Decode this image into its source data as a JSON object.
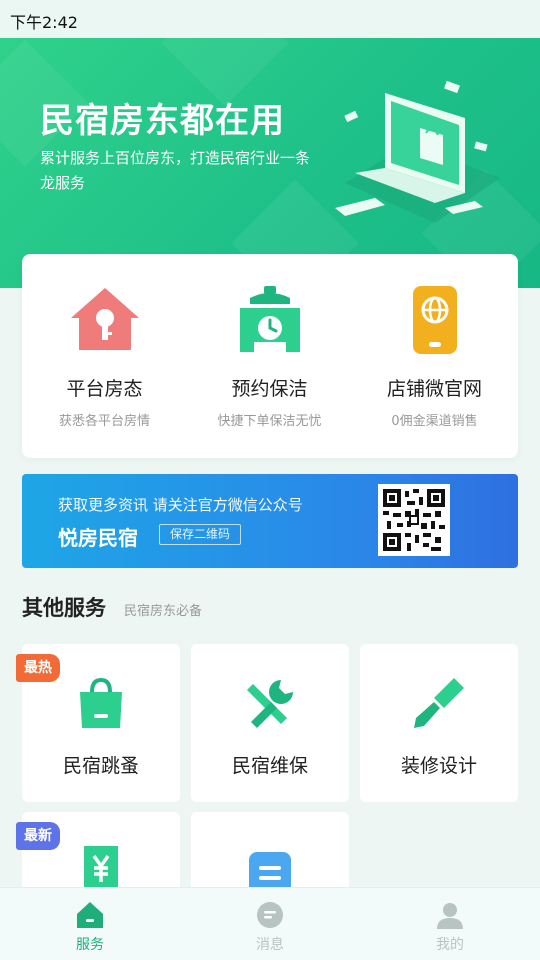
{
  "status_bar": {
    "time": "下午2:42"
  },
  "hero": {
    "title": "民宿房东都在用",
    "subtitle": "累计服务上百位房东，打造民宿行业一条龙服务"
  },
  "main_services": [
    {
      "title": "平台房态",
      "desc": "获悉各平台房情",
      "icon": "house-key-icon"
    },
    {
      "title": "预约保洁",
      "desc": "快捷下单保洁无忧",
      "icon": "clock-cleaning-icon"
    },
    {
      "title": "店铺微官网",
      "desc": "0佣金渠道销售",
      "icon": "phone-globe-icon"
    }
  ],
  "banner": {
    "line1": "获取更多资讯 请关注官方微信公众号",
    "brand": "悦房民宿",
    "button_label": "保存二维码"
  },
  "other_services": {
    "title": "其他服务",
    "subtitle": "民宿房东必备",
    "tiles": [
      {
        "label": "民宿跳蚤",
        "badge": "最热",
        "icon": "shopping-bag-icon"
      },
      {
        "label": "民宿维保",
        "badge": "",
        "icon": "tools-icon"
      },
      {
        "label": "装修设计",
        "badge": "",
        "icon": "paint-brush-icon"
      },
      {
        "label": "",
        "badge": "最新",
        "icon": "yen-icon"
      },
      {
        "label": "",
        "badge": "",
        "icon": "list-icon"
      }
    ]
  },
  "tabbar": {
    "items": [
      {
        "label": "服务",
        "active": true,
        "icon": "home-icon"
      },
      {
        "label": "消息",
        "active": false,
        "icon": "message-icon"
      },
      {
        "label": "我的",
        "active": false,
        "icon": "user-icon"
      }
    ]
  },
  "colors": {
    "brand_green": "#1fc18a",
    "hot_badge": "#f26b36",
    "new_badge": "#5f73e8",
    "banner_blue": "#2b86e8",
    "tab_active": "#1fae7a",
    "tab_inactive": "#b8c4c2"
  }
}
